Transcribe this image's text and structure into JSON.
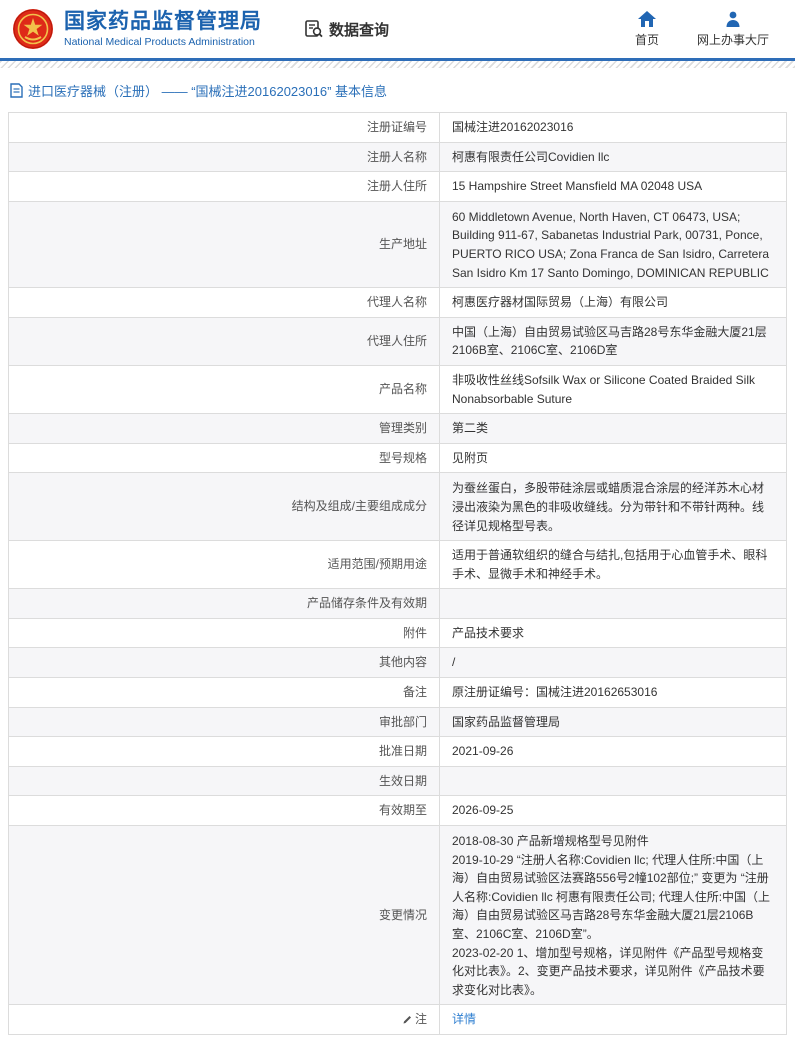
{
  "header": {
    "agency_cn": "国家药品监督管理局",
    "agency_en": "National Medical Products Administration",
    "data_query_label": "数据查询",
    "nav": [
      {
        "label": "首页"
      },
      {
        "label": "网上办事大厅"
      }
    ]
  },
  "breadcrumb": {
    "text": "进口医疗器械（注册） —— “国械注进20162023016” 基本信息"
  },
  "table": {
    "rows": [
      {
        "label": "注册证编号",
        "value": "国械注进20162023016"
      },
      {
        "label": "注册人名称",
        "value": "柯惠有限责任公司Covidien llc"
      },
      {
        "label": "注册人住所",
        "value": "15 Hampshire Street Mansfield MA 02048 USA"
      },
      {
        "label": "生产地址",
        "value": "60 Middletown Avenue, North Haven, CT 06473, USA; Building 911-67, Sabanetas Industrial Park, 00731, Ponce, PUERTO RICO USA; Zona Franca de San Isidro, Carretera San Isidro Km 17 Santo Domingo, DOMINICAN REPUBLIC"
      },
      {
        "label": "代理人名称",
        "value": "柯惠医疗器材国际贸易（上海）有限公司"
      },
      {
        "label": "代理人住所",
        "value": "中国（上海）自由贸易试验区马吉路28号东华金融大厦21层2106B室、2106C室、2106D室"
      },
      {
        "label": "产品名称",
        "value": "非吸收性丝线Sofsilk Wax or Silicone Coated Braided Silk Nonabsorbable Suture"
      },
      {
        "label": "管理类别",
        "value": "第二类"
      },
      {
        "label": "型号规格",
        "value": "见附页"
      },
      {
        "label": "结构及组成/主要组成成分",
        "value": "为蚕丝蛋白，多股带硅涂层或蜡质混合涂层的经洋苏木心材浸出液染为黑色的非吸收缝线。分为带针和不带针两种。线径详见规格型号表。"
      },
      {
        "label": "适用范围/预期用途",
        "value": "适用于普通软组织的缝合与结扎,包括用于心血管手术、眼科手术、显微手术和神经手术。"
      },
      {
        "label": "产品储存条件及有效期",
        "value": ""
      },
      {
        "label": "附件",
        "value": "产品技术要求"
      },
      {
        "label": "其他内容",
        "value": "/"
      },
      {
        "label": "备注",
        "value": "原注册证编号：国械注进20162653016"
      },
      {
        "label": "审批部门",
        "value": "国家药品监督管理局"
      },
      {
        "label": "批准日期",
        "value": "2021-09-26"
      },
      {
        "label": "生效日期",
        "value": ""
      },
      {
        "label": "有效期至",
        "value": "2026-09-25"
      },
      {
        "label": "变更情况",
        "value": "2018-08-30 产品新增规格型号见附件\n2019-10-29 “注册人名称:Covidien llc; 代理人住所:中国（上海）自由贸易试验区法赛路556号2幢102部位;” 变更为 “注册人名称:Covidien llc 柯惠有限责任公司; 代理人住所:中国（上海）自由贸易试验区马吉路28号东华金融大厦21层2106B室、2106C室、2106D室”。\n2023-02-20 1、增加型号规格，详见附件《产品型号规格变化对比表》。2、变更产品技术要求，详见附件《产品技术要求变化对比表》。"
      }
    ],
    "note_row": {
      "label": "注",
      "link_label": "详情"
    }
  },
  "colors": {
    "brand_blue": "#1b62ae",
    "nav_icon_blue": "#2166b3",
    "link_blue": "#2f7fd1",
    "emblem_red": "#de2a18",
    "emblem_gold": "#f2c14b"
  }
}
